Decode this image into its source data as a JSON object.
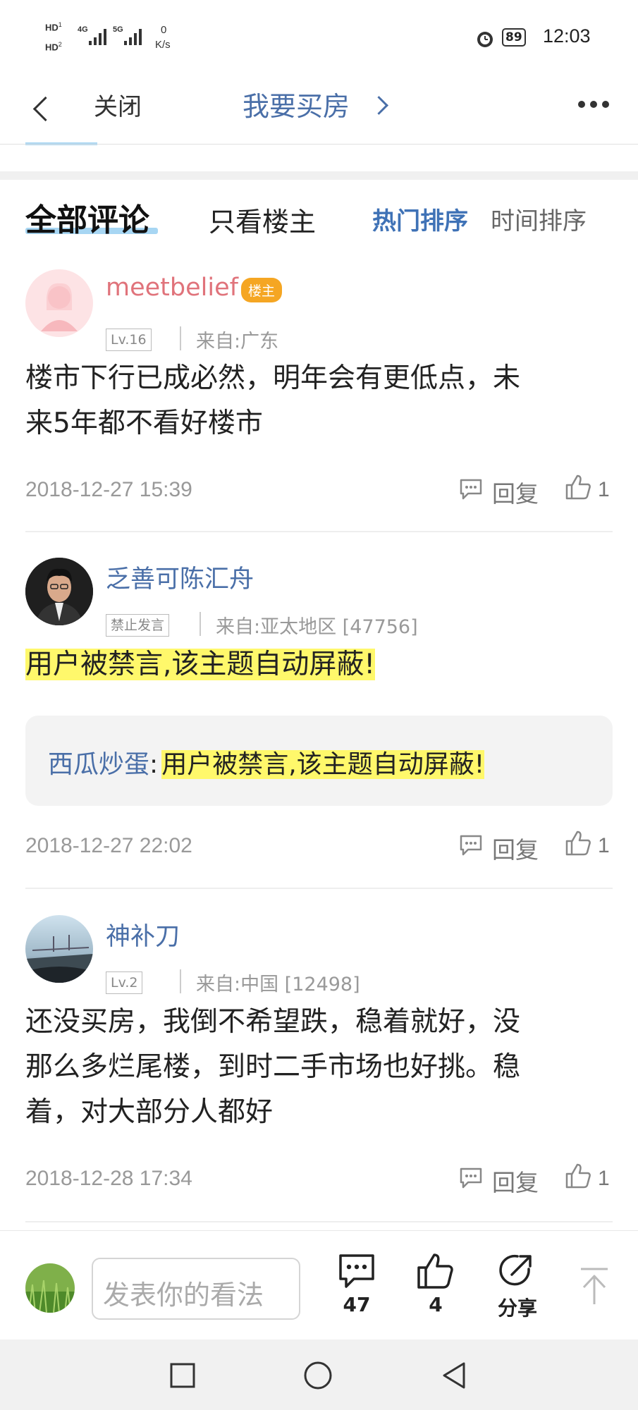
{
  "status_bar": {
    "hd1": "HD",
    "hd1_sub": "1",
    "hd2": "HD",
    "hd2_sub": "2",
    "net1": "4G",
    "net2": "5G",
    "speed_value": "0",
    "speed_unit": "K/s",
    "battery": "89",
    "time": "12:03"
  },
  "header": {
    "close_label": "关闭",
    "title": "我要买房"
  },
  "tabs": {
    "all_comments": "全部评论",
    "host_only": "只看楼主",
    "sort_hot": "热门排序",
    "sort_time": "时间排序"
  },
  "comments": [
    {
      "username": "meetbelief",
      "username_color": "#e0737b",
      "host_badge": "楼主",
      "level": "Lv.16",
      "location": "来自:广东",
      "text_line1": "楼市下行已成必然，明年会有更低点，未",
      "text_line2": "来5年都不看好楼市",
      "timestamp": "2018-12-27 15:39",
      "reply_label": "回复",
      "likes": "1"
    },
    {
      "username": "乏善可陈汇舟",
      "username_color": "#4a6fa8",
      "level": "禁止发言",
      "location": "来自:亚太地区 [47756]",
      "text_line1": "用户被禁言,该主题自动屏蔽!",
      "quote_name": "西瓜炒蛋",
      "quote_sep": ":",
      "quote_text": "用户被禁言,该主题自动屏蔽!",
      "timestamp": "2018-12-27 22:02",
      "reply_label": "回复",
      "likes": "1"
    },
    {
      "username": "神补刀",
      "username_color": "#4a6fa8",
      "level": "Lv.2",
      "location": "来自:中国 [12498]",
      "text_line1": "还没买房，我倒不希望跌，稳着就好，没",
      "text_line2": "那么多烂尾楼，到时二手市场也好挑。稳",
      "text_line3": "着，对大部分人都好",
      "timestamp": "2018-12-28 17:34",
      "reply_label": "回复",
      "likes": "1"
    }
  ],
  "bottom_bar": {
    "input_placeholder": "发表你的看法",
    "comment_count": "47",
    "like_count": "4",
    "share_label": "分享"
  },
  "colors": {
    "accent_blue": "#4a6fa8",
    "highlight_yellow": "#fff86b",
    "host_badge": "#f5a623"
  }
}
